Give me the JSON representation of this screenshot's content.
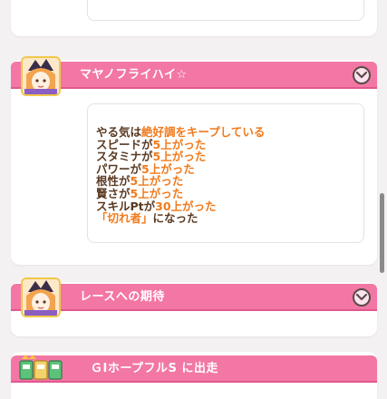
{
  "events": [
    {
      "title": "マヤノフライハイ☆",
      "effects": [
        [
          {
            "t": "やる気は",
            "h": false
          },
          {
            "t": "絶好調",
            "h": true
          },
          {
            "t": "をキープしている",
            "h": true
          }
        ],
        [
          {
            "t": "スピードが",
            "h": false
          },
          {
            "t": "5上がった",
            "h": true
          }
        ],
        [
          {
            "t": "スタミナが",
            "h": false
          },
          {
            "t": "5上がった",
            "h": true
          }
        ],
        [
          {
            "t": "パワーが",
            "h": false
          },
          {
            "t": "5上がった",
            "h": true
          }
        ],
        [
          {
            "t": "根性が",
            "h": false
          },
          {
            "t": "5上がった",
            "h": true
          }
        ],
        [
          {
            "t": "賢さが",
            "h": false
          },
          {
            "t": "5上がった",
            "h": true
          }
        ],
        [
          {
            "t": "スキルPtが",
            "h": false
          },
          {
            "t": "30上がった",
            "h": true
          }
        ],
        [
          {
            "t": "「切れ者」",
            "h": true
          },
          {
            "t": "になった",
            "h": false
          }
        ]
      ]
    },
    {
      "title": "レースへの期待"
    },
    {
      "title": "ＧⅠホープフルS に出走"
    }
  ],
  "colors": {
    "header_pink": "#f277a4",
    "highlight_orange": "#f07a1c",
    "text_brown": "#5a3a22"
  },
  "icons": {
    "expand": "chevron-down-icon",
    "avatar": "character-avatar",
    "race": "race-cards-icon"
  }
}
